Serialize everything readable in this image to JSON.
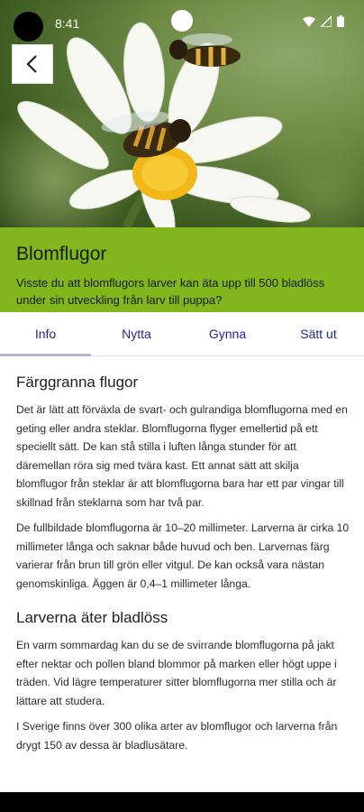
{
  "status_bar": {
    "time": "8:41"
  },
  "hero": {
    "image_alt": "blomfluga på prästkrage"
  },
  "header": {
    "title": "Blomflugor",
    "subtitle": "Visste du att blomflugors larver kan äta upp till 500 bladlöss under sin utveckling från larv till puppa?"
  },
  "tabs": [
    {
      "label": "Info",
      "active": true
    },
    {
      "label": "Nytta",
      "active": false
    },
    {
      "label": "Gynna",
      "active": false
    },
    {
      "label": "Sätt ut",
      "active": false
    }
  ],
  "content": {
    "section1": {
      "heading": "Färggranna flugor",
      "p1": "Det är lätt att förväxla de svart- och gulrandiga blomflugorna med en geting eller andra steklar. Blomflugorna flyger emellertid på ett speciellt sätt. De kan stå stilla i luften långa stunder för att däremellan röra sig med tvära kast. Ett annat sätt att skilja blomflugor från steklar är att blomflugorna bara har ett par vingar till skillnad från steklarna som har två par.",
      "p2": "De fullbildade blomflugorna är 10–20 millimeter. Larverna är cirka 10 millimeter långa och saknar både huvud och ben. Larvernas färg varierar från brun till grön eller vitgul. De kan också vara nästan genomskinliga. Äggen är 0,4–1 millimeter långa."
    },
    "section2": {
      "heading": "Larverna äter bladlöss",
      "p1": "En varm sommardag kan du se de svirrande blomflugorna på jakt efter nektar och pollen bland blommor på marken eller högt uppe i träden. Vid lägre temperaturer sitter blomflugorna mer stilla och är lättare att studera.",
      "p2": "I Sverige finns över 300 olika arter av blomflugor och larverna från drygt 150 av dessa är bladlusätare."
    }
  },
  "colors": {
    "banner": "#81b61c",
    "tab_text": "#1e2a8a",
    "tab_indicator": "#b9b3d9"
  }
}
